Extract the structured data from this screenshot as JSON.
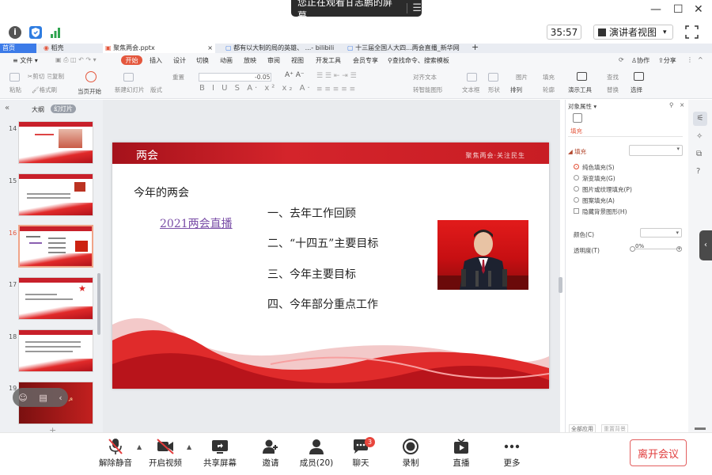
{
  "banner": {
    "text": "您正在观看甘志鹏的屏幕",
    "menu_icon": "menu-icon"
  },
  "window": {
    "minimize": "—",
    "maximize": "☐",
    "close": "✕"
  },
  "meeting_top": {
    "timer": "35:57",
    "presenter_view": "演讲者视图",
    "presenter_caret": "▾"
  },
  "tabs": [
    {
      "label": "首页"
    },
    {
      "label": "稻壳"
    },
    {
      "label": "聚焦两会.pptx"
    },
    {
      "label": "都有以大制的局的英雄、 ...- bilibili"
    },
    {
      "label": "十三届全国人大四...两会直播_新华网"
    }
  ],
  "menu": {
    "file": "≡ 文件 ▾",
    "start": "开始",
    "items": [
      "插入",
      "设计",
      "切换",
      "动画",
      "放映",
      "审阅",
      "视图",
      "开发工具",
      "会员专享"
    ],
    "search": "查找命令、搜索模板",
    "collab": "协作",
    "share": "分享"
  },
  "toolbar": {
    "paste": "粘贴",
    "cut": "剪切",
    "copy": "复制",
    "format_painter": "格式刷",
    "play_from_current": "当页开始",
    "new_slide": "新建幻灯片",
    "layout": "版式",
    "reset": "重置",
    "font_size_delta": "-0.05",
    "align_text": "对齐文本",
    "convert_smartart": "转智能图形",
    "textbox": "文本框",
    "shape": "形状",
    "arrange": "排列",
    "image": "图片",
    "fill": "填充",
    "outline": "轮廓",
    "find": "查找",
    "replace": "替换",
    "present_tools": "演示工具",
    "select": "选择"
  },
  "left_panel": {
    "outline": "大纲",
    "slides": "幻灯片",
    "slide_numbers": [
      "14",
      "15",
      "16",
      "17",
      "18",
      "19"
    ]
  },
  "slide": {
    "title": "两会",
    "slogan": "聚焦两会·关注民生",
    "subtitle": "今年的两会",
    "link": "2021两会直播",
    "agenda": [
      "一、去年工作回顾",
      "二、“十四五”主要目标",
      "三、今年主要目标",
      "四、今年部分重点工作"
    ]
  },
  "right_panel": {
    "title": "对象属性 ▾",
    "fill_tab": "填充",
    "fill_section": "◢ 填充",
    "options": [
      "纯色填充(S)",
      "渐变填充(G)",
      "图片或纹理填充(P)",
      "图案填充(A)"
    ],
    "hide_bg": "隐藏背景图形(H)",
    "color_label": "颜色(C)",
    "transparency_label": "透明度(T)",
    "transparency_value": "0%",
    "apply_all": "全部应用",
    "reset_bg": "重置背景"
  },
  "bottom_bar": {
    "items": [
      "解除静音",
      "开启视频",
      "共享屏幕",
      "邀请",
      "成员(20)",
      "聊天",
      "录制",
      "直播",
      "更多"
    ],
    "chat_badge": "3",
    "leave": "离开会议"
  },
  "colors": {
    "accent_red": "#e4573d",
    "slide_red": "#c81d24",
    "link_purple": "#7a4ea7",
    "leave_red": "#e03c3c"
  }
}
